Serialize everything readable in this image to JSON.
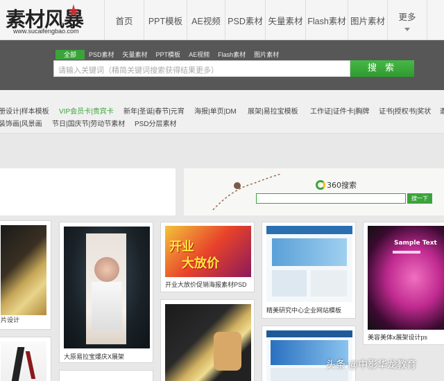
{
  "site": {
    "logo_text": "素材风暴",
    "logo_url": "www.sucaifengbao.com"
  },
  "nav": {
    "items": [
      "首页",
      "PPT模板",
      "AE视频",
      "PSD素材",
      "矢量素材",
      "Flash素材",
      "图片素材",
      "更多"
    ]
  },
  "search": {
    "tabs": [
      "全部",
      "PSD素材",
      "矢量素材",
      "PPT模板",
      "AE视频",
      "Flash素材",
      "图片素材"
    ],
    "placeholder": "请输入关键词（精简关键词搜索获得结果更多）",
    "button": "搜 索"
  },
  "categories": {
    "row1": [
      "册设计|样本模板",
      "VIP会员卡|贵宾卡",
      "新年|圣诞|春节|元宵",
      "海报|单页|DM",
      "展架|易拉宝模板",
      "工作证|证件卡|胸牌",
      "证书|授权书|奖状",
      "邀"
    ],
    "row2": [
      "装饰画|风景画",
      "节日|国庆节|劳动节素材",
      "PSD分层素材"
    ]
  },
  "ad": {
    "brand": "360搜索",
    "button": "搜一下"
  },
  "cards": [
    {
      "caption": "片设计"
    },
    {
      "caption": "大原易拉宝爆庆X展架"
    },
    {
      "caption": "开业大放价促销海报素材PSD",
      "thumb_text_1": "开业",
      "thumb_text_2": "大放价"
    },
    {
      "caption": "精美研究中心企业网站模板"
    },
    {
      "caption": "美容美体x展架设计ps",
      "thumb_text": "Sample Text"
    }
  ],
  "watermark": "头条 @中影华龙教育",
  "colors": {
    "accent_green": "#3aa43a",
    "search_band": "#575757"
  }
}
